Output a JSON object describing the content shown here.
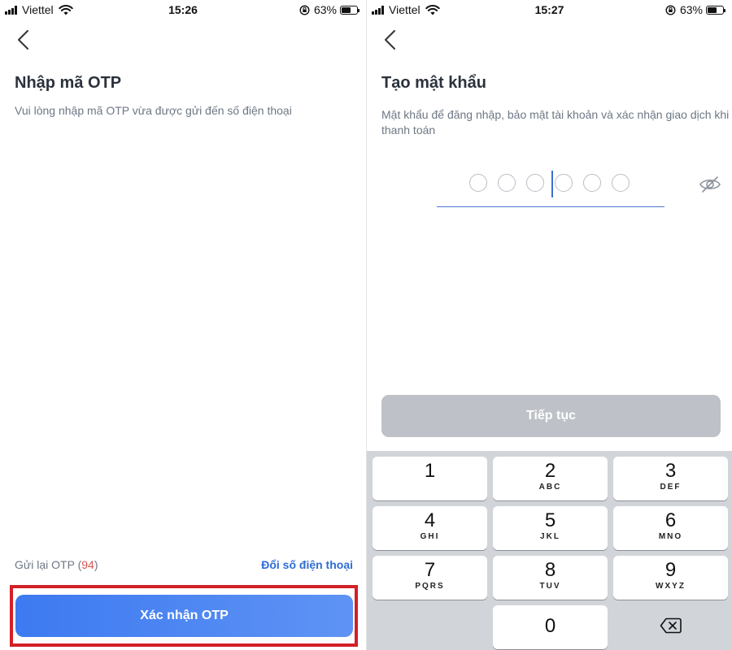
{
  "left_screen": {
    "status_bar": {
      "carrier": "Viettel",
      "time": "15:26",
      "battery": "63%",
      "battery_level": 0.63
    },
    "title": "Nhập mã OTP",
    "subtitle": "Vui lòng nhập mã OTP vừa được gửi đến số điện thoại",
    "resend_label": "Gửi lại OTP (",
    "resend_countdown": "94",
    "resend_close": ")",
    "change_phone": "Đổi số điện thoại",
    "confirm_button": "Xác nhận OTP",
    "highlight_color": "#d32027",
    "accent_color": "#3d7af1"
  },
  "right_screen": {
    "status_bar": {
      "carrier": "Viettel",
      "time": "15:27",
      "battery": "63%",
      "battery_level": 0.63
    },
    "title": "Tạo mật khẩu",
    "subtitle": "Mật khẩu để đăng nhập, bảo mật tài khoản và xác nhận giao dịch khi thanh toán",
    "pin_length": 6,
    "pin_filled": 0,
    "eye_icon": "eye-slash-icon",
    "continue_button": "Tiếp tục",
    "keypad": {
      "keys": [
        {
          "digit": "1",
          "letters": ""
        },
        {
          "digit": "2",
          "letters": "ABC"
        },
        {
          "digit": "3",
          "letters": "DEF"
        },
        {
          "digit": "4",
          "letters": "GHI"
        },
        {
          "digit": "5",
          "letters": "JKL"
        },
        {
          "digit": "6",
          "letters": "MNO"
        },
        {
          "digit": "7",
          "letters": "PQRS"
        },
        {
          "digit": "8",
          "letters": "TUV"
        },
        {
          "digit": "9",
          "letters": "WXYZ"
        },
        {
          "digit": "0",
          "letters": ""
        }
      ],
      "delete_icon": "backspace-icon"
    }
  }
}
